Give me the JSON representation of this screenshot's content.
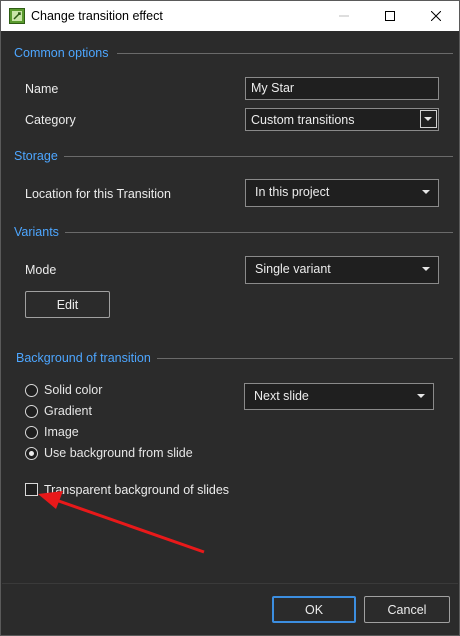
{
  "window": {
    "title": "Change transition effect",
    "controls": {
      "minimize": "minimize-icon",
      "maximize": "maximize-icon",
      "close": "close-icon"
    }
  },
  "common_options": {
    "heading": "Common options",
    "name_label": "Name",
    "name_value": "My Star",
    "category_label": "Category",
    "category_value": "Custom transitions"
  },
  "storage": {
    "heading": "Storage",
    "location_label": "Location for this Transition",
    "location_value": "In this project"
  },
  "variants": {
    "heading": "Variants",
    "mode_label": "Mode",
    "mode_value": "Single variant",
    "edit_label": "Edit"
  },
  "background": {
    "heading": "Background of transition",
    "options": [
      "Solid color",
      "Gradient",
      "Image",
      "Use background from slide"
    ],
    "selected_index": 3,
    "slide_value": "Next slide",
    "transparent_label": "Transparent background of slides",
    "transparent_checked": false
  },
  "buttons": {
    "ok": "OK",
    "cancel": "Cancel"
  },
  "colors": {
    "accent": "#4da6ff",
    "annotation_arrow": "#e8191a",
    "default_button_border": "#3c8ee0"
  }
}
